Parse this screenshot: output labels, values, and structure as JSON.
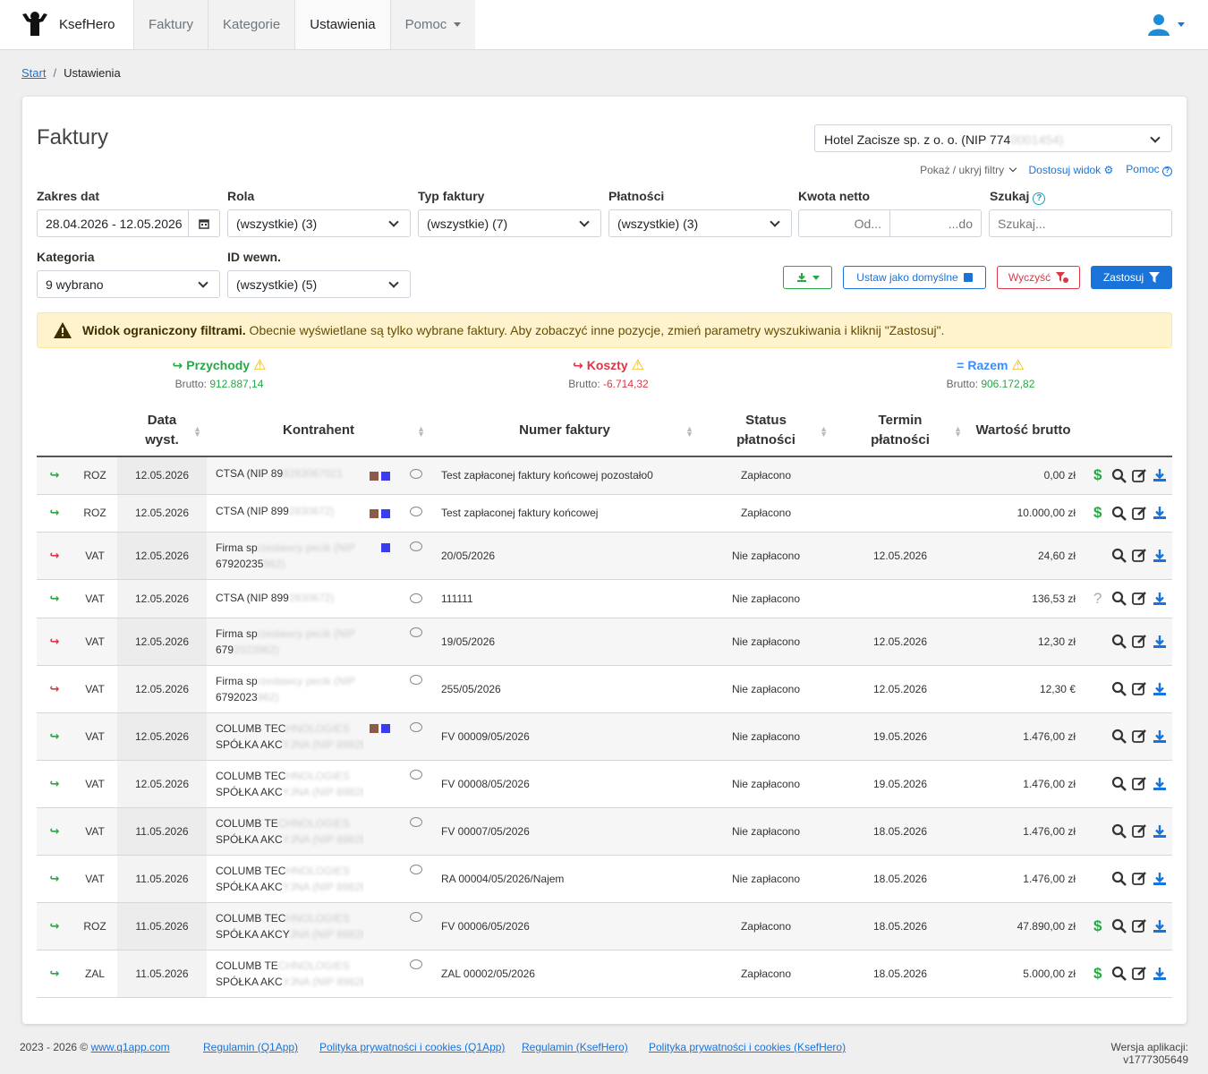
{
  "app": {
    "name": "KsefHero"
  },
  "nav": {
    "tabs": [
      "Faktury",
      "Kategorie",
      "Ustawienia",
      "Pomoc"
    ],
    "active": "Ustawienia"
  },
  "breadcrumb": {
    "home": "Start",
    "current": "Ustawienia"
  },
  "page": {
    "title": "Faktury",
    "company": "Hotel Zacisze sp. z o. o. (NIP 774",
    "company_hidden": "0001454)"
  },
  "toplinks": {
    "toggle": "Pokaż / ukryj filtry",
    "customize": "Dostosuj widok",
    "help": "Pomoc"
  },
  "filters": {
    "date_label": "Zakres dat",
    "date_value": "28.04.2026 - 12.05.2026",
    "role_label": "Rola",
    "role_value": "(wszystkie) (3)",
    "type_label": "Typ faktury",
    "type_value": "(wszystkie) (7)",
    "pay_label": "Płatności",
    "pay_value": "(wszystkie) (3)",
    "amount_label": "Kwota netto",
    "amount_from": "Od...",
    "amount_to": "...do",
    "search_label": "Szukaj",
    "search_placeholder": "Szukaj...",
    "cat_label": "Kategoria",
    "cat_value": "9 wybrano",
    "id_label": "ID wewn.",
    "id_value": "(wszystkie) (5)"
  },
  "buttons": {
    "default": "Ustaw jako domyślne",
    "clear": "Wyczyść",
    "apply": "Zastosuj"
  },
  "alert": {
    "bold": "Widok ograniczony filtrami.",
    "text": " Obecnie wyświetlane są tylko wybrane faktury. Aby zobaczyć inne pozycje, zmień parametry wyszukiwania i kliknij \"Zastosuj\"."
  },
  "summary": {
    "income": {
      "label": "Przychody",
      "brutto_label": "Brutto: ",
      "value": "912.887,14",
      "color": "#28a745"
    },
    "cost": {
      "label": "Koszty",
      "brutto_label": "Brutto: ",
      "value": "-6.714,32",
      "color": "#dc3545"
    },
    "total": {
      "label": "Razem",
      "brutto_label": "Brutto: ",
      "value": "906.172,82",
      "color": "#3d8bfd"
    }
  },
  "table": {
    "headers": {
      "date": "Data wyst.",
      "contractor": "Kontrahent",
      "number": "Numer faktury",
      "status": "Status płatności",
      "due": "Termin płatności",
      "gross": "Wartość brutto"
    },
    "rows": [
      {
        "dir": "in",
        "type": "ROZ",
        "date": "12.05.2026",
        "k1": "CTSA (NIP 89",
        "k1h": "8283067021",
        "k2": "",
        "k2h": "",
        "sq": [
          "brown",
          "blue"
        ],
        "number": "Test zapłaconej faktury końcowej pozostało0",
        "status": "Zapłacono",
        "due": "",
        "gross": "0,00 zł",
        "pay": "dollar",
        "h": 42
      },
      {
        "dir": "in",
        "type": "ROZ",
        "date": "12.05.2026",
        "k1": "CTSA (NIP 899",
        "k1h": "2830672)",
        "k2": "",
        "k2h": "",
        "sq": [
          "brown",
          "blue"
        ],
        "number": "Test zapłaconej faktury końcowej",
        "status": "Zapłacono",
        "due": "",
        "gross": "10.000,00 zł",
        "pay": "dollar",
        "h": 42
      },
      {
        "dir": "out",
        "type": "VAT",
        "date": "12.05.2026",
        "k1": "Firma sp",
        "k1h": "rzedawcy pecik (NIP",
        "k2": "67920235",
        "k2h": "962)",
        "sq": [
          "blue"
        ],
        "number": "20/05/2026",
        "status": "Nie zapłacono",
        "due": "12.05.2026",
        "gross": "24,60 zł",
        "pay": "",
        "h": 53
      },
      {
        "dir": "in",
        "type": "VAT",
        "date": "12.05.2026",
        "k1": "CTSA (NIP 899",
        "k1h": "2830672)",
        "k2": "",
        "k2h": "",
        "sq": [],
        "number": "111111",
        "status": "Nie zapłacono",
        "due": "",
        "gross": "136,53 zł",
        "pay": "question",
        "h": 43
      },
      {
        "dir": "out",
        "type": "VAT",
        "date": "12.05.2026",
        "k1": "Firma sp",
        "k1h": "rzedawcy pecik (NIP",
        "k2": "679",
        "k2h": "2023962)",
        "sq": [],
        "number": "19/05/2026",
        "status": "Nie zapłacono",
        "due": "12.05.2026",
        "gross": "12,30 zł",
        "pay": "",
        "h": 53
      },
      {
        "dir": "out",
        "type": "VAT",
        "date": "12.05.2026",
        "k1": "Firma sp",
        "k1h": "rzedawcy pecik (NIP",
        "k2": "6792023",
        "k2h": "962)",
        "sq": [],
        "number": "255/05/2026",
        "status": "Nie zapłacono",
        "due": "12.05.2026",
        "gross": "12,30 €",
        "pay": "",
        "h": 53
      },
      {
        "dir": "in",
        "type": "VAT",
        "date": "12.05.2026",
        "k1": "COLUMB TEC",
        "k1h": "HNOLOGIES",
        "k2": "SPÓŁKA AKC",
        "k2h": "YJNA (NIP 8982830721)",
        "sq": [
          "brown",
          "blue"
        ],
        "number": "FV 00009/05/2026",
        "status": "Nie zapłacono",
        "due": "19.05.2026",
        "gross": "1.476,00 zł",
        "pay": "",
        "h": 53
      },
      {
        "dir": "in",
        "type": "VAT",
        "date": "12.05.2026",
        "k1": "COLUMB TEC",
        "k1h": "HNOLOGIES",
        "k2": "SPÓŁKA AKC",
        "k2h": "YJNA (NIP 8982830721)",
        "sq": [],
        "number": "FV 00008/05/2026",
        "status": "Nie zapłacono",
        "due": "19.05.2026",
        "gross": "1.476,00 zł",
        "pay": "",
        "h": 53
      },
      {
        "dir": "in",
        "type": "VAT",
        "date": "11.05.2026",
        "k1": "COLUMB TE",
        "k1h": "CHNOLOGIES",
        "k2": "SPÓŁKA AKC",
        "k2h": "YJNA (NIP 8982830721)",
        "sq": [],
        "number": "FV 00007/05/2026",
        "status": "Nie zapłacono",
        "due": "18.05.2026",
        "gross": "1.476,00 zł",
        "pay": "",
        "h": 53
      },
      {
        "dir": "in",
        "type": "VAT",
        "date": "11.05.2026",
        "k1": "COLUMB TEC",
        "k1h": "HNOLOGIES",
        "k2": "SPÓŁKA AKC",
        "k2h": "YJNA (NIP 8982830721)",
        "sq": [],
        "number": "RA 00004/05/2026/Najem",
        "status": "Nie zapłacono",
        "due": "18.05.2026",
        "gross": "1.476,00 zł",
        "pay": "",
        "h": 53
      },
      {
        "dir": "in",
        "type": "ROZ",
        "date": "11.05.2026",
        "k1": "COLUMB TEC",
        "k1h": "HNOLOGIES",
        "k2": "SPÓŁKA AKCY",
        "k2h": "JNA (NIP 8982830721)",
        "sq": [],
        "number": "FV 00006/05/2026",
        "status": "Zapłacono",
        "due": "18.05.2026",
        "gross": "47.890,00 zł",
        "pay": "dollar",
        "h": 53
      },
      {
        "dir": "in",
        "type": "ZAL",
        "date": "11.05.2026",
        "k1": "COLUMB TE",
        "k1h": "CHNOLOGIES",
        "k2": "SPÓŁKA AKC",
        "k2h": "YJNA (NIP 8982830721)",
        "sq": [],
        "number": "ZAL 00002/05/2026",
        "status": "Zapłacono",
        "due": "18.05.2026",
        "gross": "5.000,00 zł",
        "pay": "dollar",
        "h": 53
      }
    ]
  },
  "footer": {
    "copyright": "2023 - 2026 © ",
    "site": "www.q1app.com",
    "l1": "Regulamin (Q1App)",
    "l2": "Polityka prywatności i cookies (Q1App)",
    "l3": "Regulamin (KsefHero)",
    "l4": "Polityka prywatności i cookies (KsefHero)",
    "version": "Wersja aplikacji: v1777305649"
  },
  "colors": {
    "primary": "#1a73d9",
    "in": "#28a745",
    "out": "#dc3545",
    "brown": "#8b5a4a",
    "blue": "#3b3bf0"
  }
}
